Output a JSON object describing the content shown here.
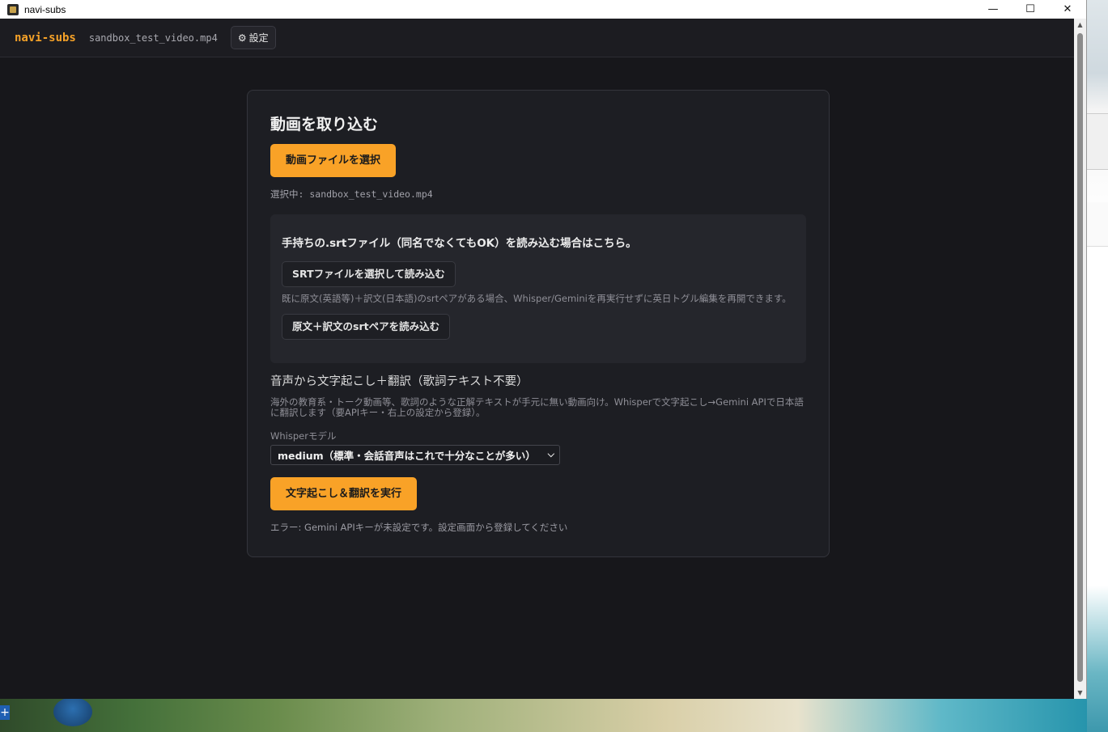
{
  "window": {
    "title": "navi-subs",
    "minimize": "—",
    "maximize": "☐",
    "close": "✕"
  },
  "header": {
    "brand": "navi-subs",
    "current_file": "sandbox_test_video.mp4",
    "settings_icon": "⚙",
    "settings_label": "設定"
  },
  "import": {
    "title": "動画を取り込む",
    "select_button": "動画ファイルを選択",
    "selected_text": "選択中: sandbox_test_video.mp4"
  },
  "srt": {
    "heading": "手持ちの.srtファイル（同名でなくてもOK）を読み込む場合はこちら。",
    "select_button": "SRTファイルを選択して読み込む",
    "description": "既に原文(英語等)＋訳文(日本語)のsrtペアがある場合、Whisper/Geminiを再実行せずに英日トグル編集を再開できます。",
    "pair_button": "原文＋訳文のsrtペアを読み込む"
  },
  "transcribe": {
    "heading": "音声から文字起こし＋翻訳（歌詞テキスト不要）",
    "description": "海外の教育系・トーク動画等、歌詞のような正解テキストが手元に無い動画向け。Whisperで文字起こし→Gemini APIで日本語に翻訳します（要APIキー・右上の設定から登録）。",
    "model_label": "Whisperモデル",
    "model_selected": "medium（標準・会話音声はこれで十分なことが多い）",
    "run_button": "文字起こし＆翻訳を実行",
    "error": "エラー: Gemini APIキーが未設定です。設定画面から登録してください"
  },
  "colors": {
    "accent": "#f9a227",
    "background": "#17171b",
    "card": "#1d1e23"
  }
}
